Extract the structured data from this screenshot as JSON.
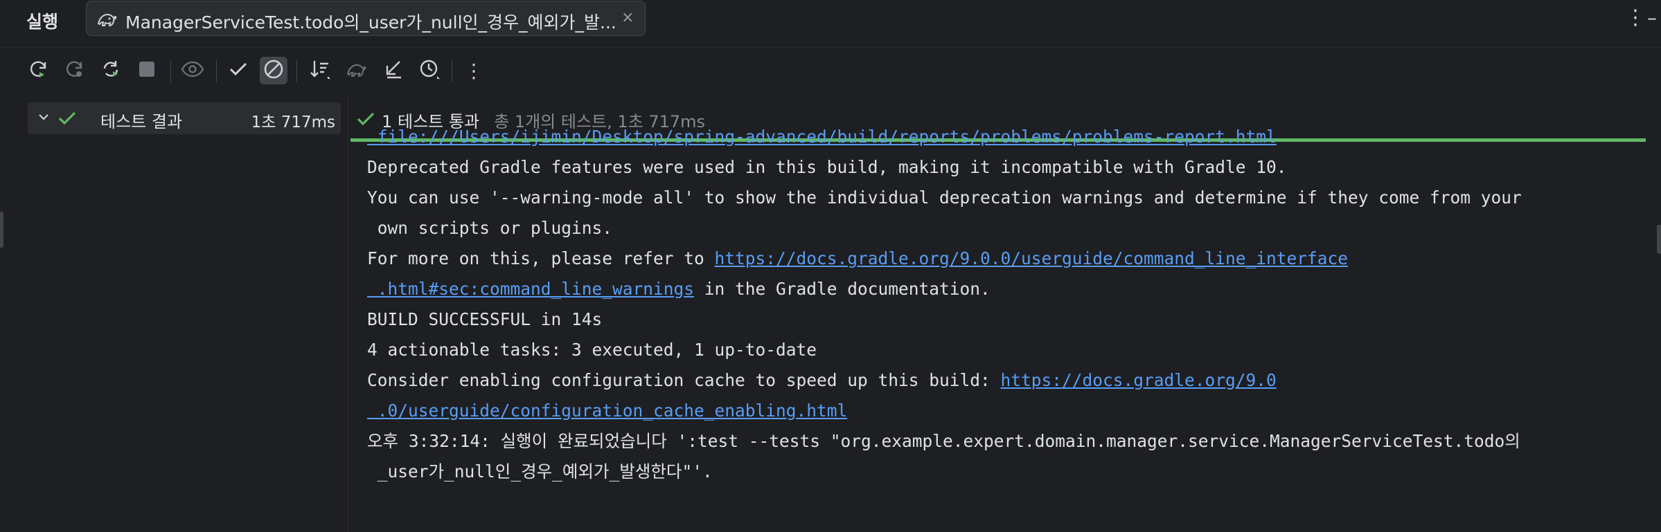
{
  "header": {
    "run_label": "실행",
    "tab_title": "ManagerServiceTest.todo의_user가_null인_경우_예외가_발...",
    "close_glyph": "×",
    "more_glyph": "⋮",
    "minimize_glyph": "–"
  },
  "toolbar": {
    "more_glyph": "⋮"
  },
  "tree": {
    "root_label": "테스트 결과",
    "root_time": "1초 717ms"
  },
  "status": {
    "passed": "1 테스트 통과",
    "total": "총 1개의 테스트, 1초 717ms"
  },
  "console": {
    "l1_link": " file:///Users/ijimin/Desktop/spring-advanced/build/reports/problems/problems-report.html",
    "l2": "Deprecated Gradle features were used in this build, making it incompatible with Gradle 10.",
    "l3": "You can use '--warning-mode all' to show the individual deprecation warnings and determine if they come from your",
    "l4": " own scripts or plugins.",
    "l5_text": "For more on this, please refer to ",
    "l5_link": "https://docs.gradle.org/9.0.0/userguide/command_line_interface",
    "l6_link": " .html#sec:command_line_warnings",
    "l6_text": " in the Gradle documentation.",
    "l7": "BUILD SUCCESSFUL in 14s",
    "l8": "4 actionable tasks: 3 executed, 1 up-to-date",
    "l9_text": "Consider enabling configuration cache to speed up this build: ",
    "l9_link": "https://docs.gradle.org/9.0",
    "l10_link": " .0/userguide/configuration_cache_enabling.html",
    "l11": "오후 3:32:14: 실행이 완료되었습니다 ':test --tests \"org.example.expert.domain.manager.service.ManagerServiceTest.todo의",
    "l12": " _user가_null인_경우_예외가_발생한다\"'."
  },
  "colors": {
    "background": "#1e1f22",
    "panel": "#2b2d30",
    "success": "#5fb865",
    "link": "#589df6",
    "text": "#dfe1e5",
    "muted": "#868a91"
  }
}
